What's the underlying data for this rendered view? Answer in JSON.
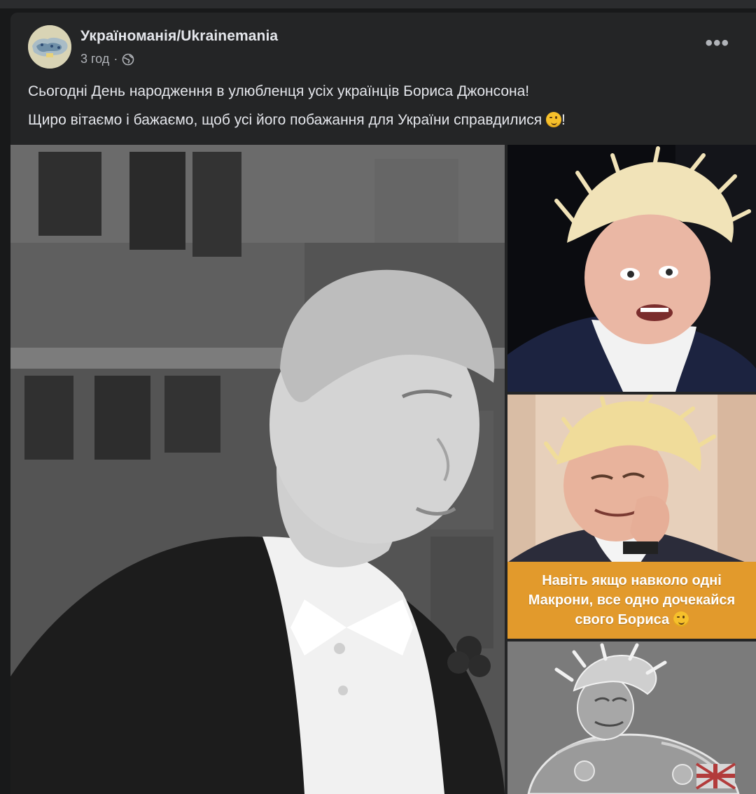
{
  "post": {
    "page_name": "Україноманія/Ukrainemania",
    "time": "3 год",
    "separator": "·",
    "privacy_icon": "globe-icon",
    "more_icon": "more-options-icon",
    "more_glyph": "•••",
    "text_line_1": "Сьогодні День народження в улюбленця усіх українців Бориса Джонсона!",
    "text_line_2_prefix": "Щиро вітаємо і бажаємо, щоб усі його побажання для України справдилися ",
    "text_line_2_emoji": "winking-face-emoji",
    "text_line_2_suffix": "!"
  },
  "images": {
    "main_photo": "black-and-white-portrait-photo",
    "side_photo_1": "color-portrait-photo",
    "side_photo_2": "meme-portrait-photo",
    "side_photo_2_caption_line_1": "Навіть якщо навколо одні",
    "side_photo_2_caption_line_2": "Макрони, все одно дочекайся",
    "side_photo_2_caption_line_3": "свого Бориса",
    "side_photo_2_caption_emoji": "smirking-face-emoji",
    "side_photo_3": "armor-illustration-photo"
  },
  "colors": {
    "background": "#18191a",
    "card": "#242526",
    "primary_text": "#e4e6eb",
    "secondary_text": "#b0b3b8",
    "caption_band": "#e29a2c"
  }
}
